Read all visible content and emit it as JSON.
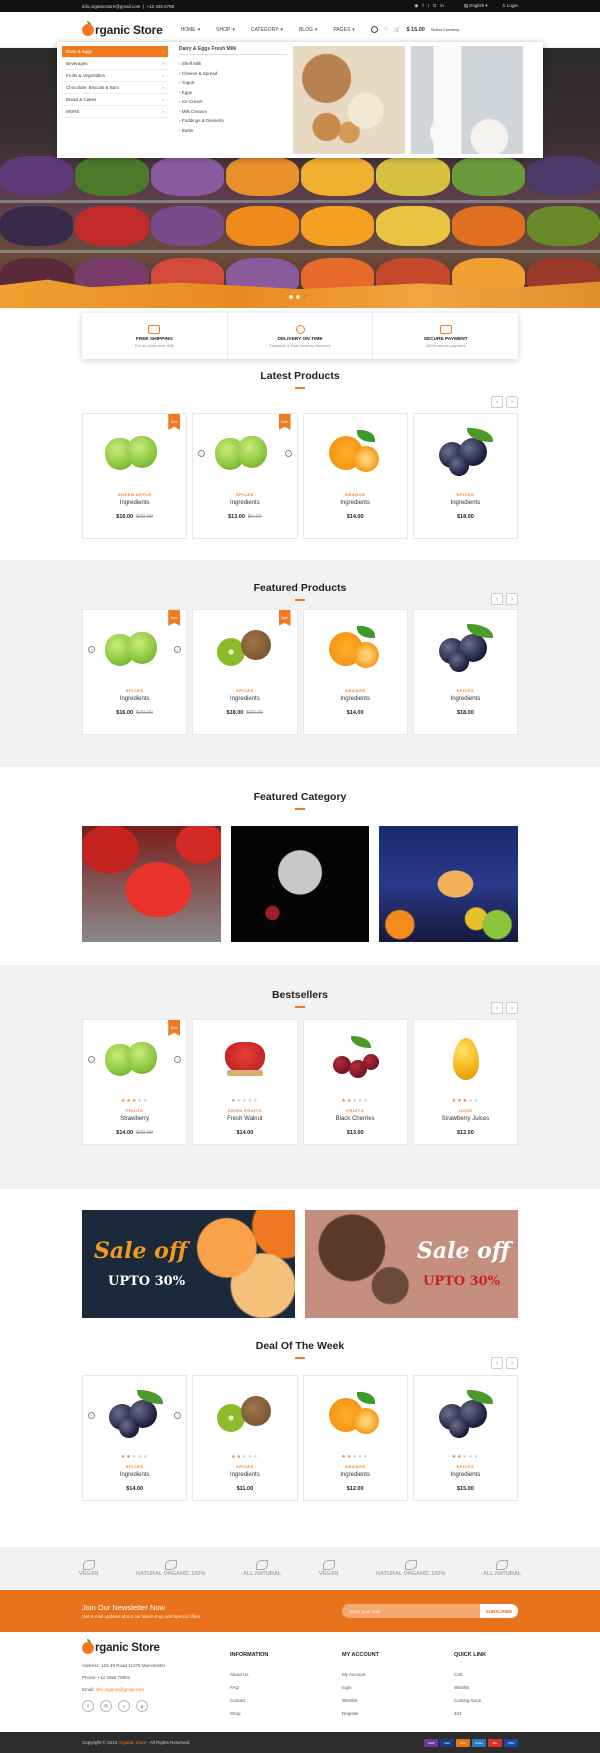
{
  "topbar": {
    "email": "info.organicstore@gmail.com",
    "phone": "+12 345 6789",
    "language": "English",
    "login": "Login"
  },
  "header": {
    "logo": "rganic Store",
    "nav": [
      "HOME",
      "SHOP",
      "CATEGORY",
      "BLOG",
      "PAGES"
    ],
    "cart_total": "$ 15.00",
    "currency": "Select Currency"
  },
  "megamenu": {
    "categories": [
      "Dairy & Eggs",
      "Beverages",
      "Fruits & Vegetables",
      "Chocolate, Biscuits & Bars",
      "Bread & Cakes",
      "MORE"
    ],
    "subtitle": "Dairy & Eggs Fresh Milk",
    "subitems": [
      "Shelf Milk",
      "Cheese & Spread",
      "Yogurt",
      "Eggs",
      "Ice Cream",
      "Milk Creams",
      "Puddings & Desserts",
      "Butter"
    ]
  },
  "features": [
    {
      "title": "FREE SHIPPING",
      "sub": "For an order over 99$"
    },
    {
      "title": "DELIVERY ON TIME",
      "sub": "Trustable & Fast Delivery Services"
    },
    {
      "title": "SECURE PAYMENT",
      "sub": "100% secure payment"
    }
  ],
  "sections": {
    "latest": "Latest Products",
    "featured": "Featured Products",
    "category": "Featured Category",
    "bestsellers": "Bestsellers",
    "deal": "Deal Of The Week"
  },
  "badge": "Sale",
  "latest_products": [
    {
      "cat": "GREEN APPLE",
      "name": "Ingredients",
      "price": "$10.00",
      "old": "$20.00",
      "fruit": "apple",
      "sale": true
    },
    {
      "cat": "SPICES",
      "name": "Ingredients",
      "price": "$13.00",
      "old": "$6.00",
      "fruit": "apple",
      "sale": true
    },
    {
      "cat": "ORANGE",
      "name": "Ingredients",
      "price": "$14.00",
      "old": "",
      "fruit": "orange",
      "sale": false
    },
    {
      "cat": "SPICES",
      "name": "Ingredients",
      "price": "$18.00",
      "old": "",
      "fruit": "plum",
      "sale": false
    }
  ],
  "featured_products": [
    {
      "cat": "SPICES",
      "name": "Ingredients",
      "price": "$16.00",
      "old": "$20.00",
      "fruit": "apple",
      "sale": true
    },
    {
      "cat": "SPICES",
      "name": "Ingredients",
      "price": "$18.00",
      "old": "$20.00",
      "fruit": "kiwi",
      "sale": true
    },
    {
      "cat": "ORANGE",
      "name": "Ingredients",
      "price": "$14.00",
      "old": "",
      "fruit": "orange",
      "sale": false
    },
    {
      "cat": "SPICES",
      "name": "Ingredients",
      "price": "$18.00",
      "old": "",
      "fruit": "plum",
      "sale": false
    }
  ],
  "bestsellers": [
    {
      "cat": "FRUITS",
      "name": "Strawberry",
      "price": "$14.00",
      "old": "$20.00",
      "fruit": "apple",
      "sale": true,
      "rating": 3
    },
    {
      "cat": "DRIED FRUITS",
      "name": "Fresh Walnut",
      "price": "$14.00",
      "old": "",
      "fruit": "straw",
      "sale": false,
      "rating": 1
    },
    {
      "cat": "FRUITS",
      "name": "Black Cherries",
      "price": "$13.00",
      "old": "",
      "fruit": "cherry",
      "sale": false,
      "rating": 2
    },
    {
      "cat": "JUICE",
      "name": "Strawberry Juices",
      "price": "$12.00",
      "old": "",
      "fruit": "mango",
      "sale": false,
      "rating": 3
    }
  ],
  "deal_products": [
    {
      "cat": "SPICES",
      "name": "Ingredients",
      "price": "$14.00",
      "old": "",
      "fruit": "plum",
      "sale": false,
      "rating": 2
    },
    {
      "cat": "SPICES",
      "name": "Ingredients",
      "price": "$11.00",
      "old": "",
      "fruit": "kiwi",
      "sale": false,
      "rating": 2
    },
    {
      "cat": "ORANGE",
      "name": "Ingredients",
      "price": "$12.00",
      "old": "",
      "fruit": "orange",
      "sale": false,
      "rating": 2
    },
    {
      "cat": "SPICES",
      "name": "Ingredients",
      "price": "$15.00",
      "old": "",
      "fruit": "plum",
      "sale": false,
      "rating": 2
    }
  ],
  "banners": [
    {
      "sale": "Sale off",
      "upto": "UPTO 30%"
    },
    {
      "sale": "Sale off",
      "upto": "UPTO 30%"
    }
  ],
  "brands": [
    "VEGAN",
    "NATURAL ORGANIC 100%",
    "ALL NATURAL",
    "VEGAN",
    "NATURAL ORGANIC 100%",
    "ALL NATURAL"
  ],
  "newsletter": {
    "title": "Join Our Newsletter Now",
    "sub": "Get E-mail updates about our latest shop and special offers.",
    "placeholder": "Enter your mail",
    "button": "SUBSCRIBE"
  },
  "footer": {
    "logo": "rganic Store",
    "address": "Address: 123-45 Road 11378 Manchester",
    "phone": "Phone: +12 3456 78901",
    "email_label": "Email:",
    "email": "info.organic@gmail.com",
    "social": [
      "f",
      "◎",
      "t",
      "p"
    ],
    "cols": [
      {
        "title": "INFORMATION",
        "links": [
          "About Us",
          "FAQ",
          "Contact",
          "Shop"
        ]
      },
      {
        "title": "MY ACCOUNT",
        "links": [
          "My Account",
          "login",
          "Wishlist",
          "Register"
        ]
      },
      {
        "title": "QUICK LINK",
        "links": [
          "Cart",
          "Wishlist",
          "Coming Soon",
          "404"
        ]
      }
    ]
  },
  "copyright": {
    "pre": "Copyright © 2019",
    "brand": "Organic Store",
    "post": "- All Rights Reserved."
  },
  "payments": [
    {
      "label": "Skrill",
      "color": "#6a3a9a"
    },
    {
      "label": "Visa",
      "color": "#1a3a8a"
    },
    {
      "label": "Disc",
      "color": "#e8731c"
    },
    {
      "label": "Amex",
      "color": "#2a7ac8"
    },
    {
      "label": "MC",
      "color": "#d8302a"
    },
    {
      "label": "VISA",
      "color": "#1a4aa8"
    }
  ]
}
